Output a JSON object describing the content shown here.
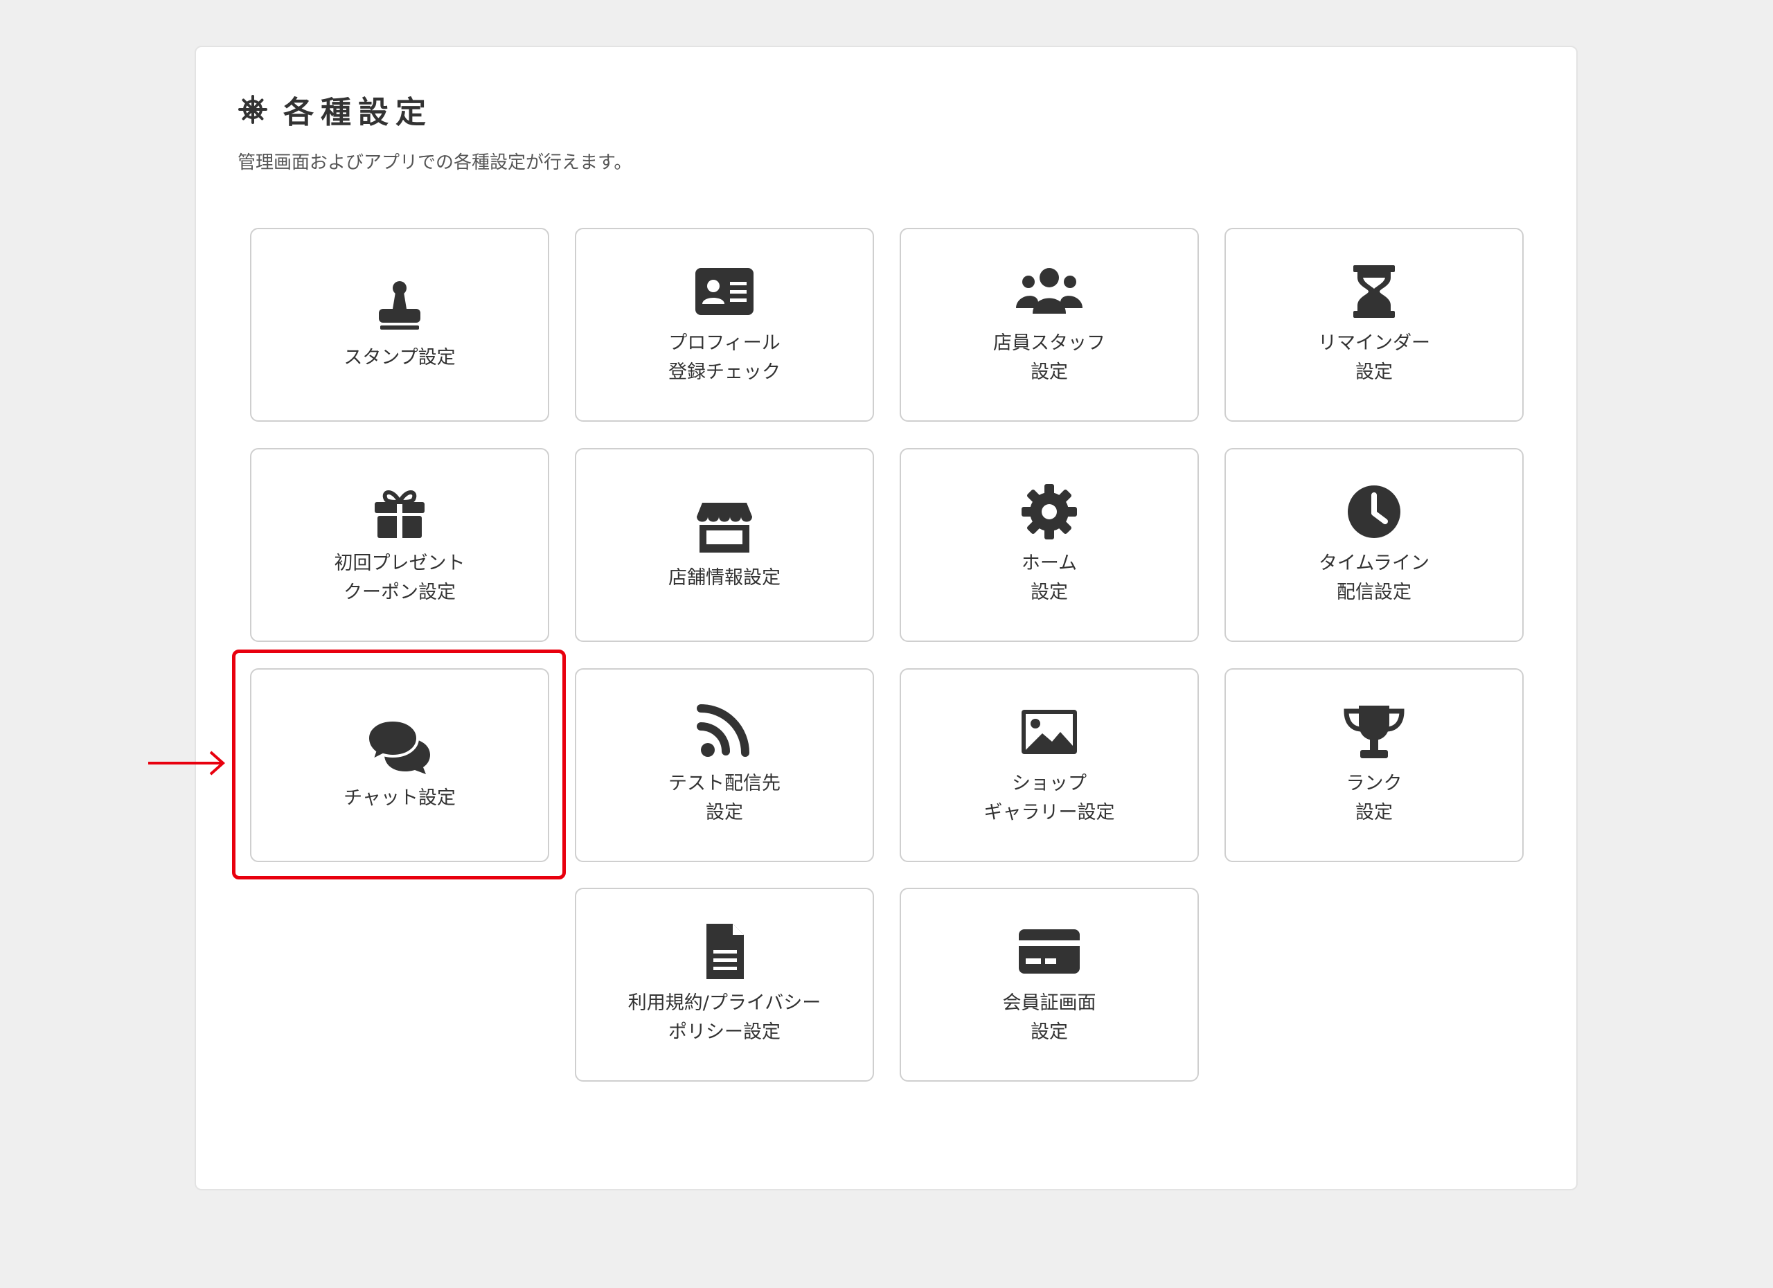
{
  "header": {
    "title": "各種設定",
    "icon": "helm-gear-icon",
    "description": "管理画面およびアプリでの各種設定が行えます。"
  },
  "tiles": [
    {
      "icon": "stamp-icon",
      "lines": [
        "スタンプ設定"
      ]
    },
    {
      "icon": "id-card-icon",
      "lines": [
        "プロフィール",
        "登録チェック"
      ]
    },
    {
      "icon": "users-icon",
      "lines": [
        "店員スタッフ",
        "設定"
      ]
    },
    {
      "icon": "hourglass-icon",
      "lines": [
        "リマインダー",
        "設定"
      ]
    },
    {
      "icon": "gift-icon",
      "lines": [
        "初回プレゼント",
        "クーポン設定"
      ]
    },
    {
      "icon": "store-icon",
      "lines": [
        "店舗情報設定"
      ]
    },
    {
      "icon": "gear-icon",
      "lines": [
        "ホーム",
        "設定"
      ]
    },
    {
      "icon": "clock-icon",
      "lines": [
        "タイムライン",
        "配信設定"
      ]
    },
    {
      "icon": "chat-bubbles-icon",
      "lines": [
        "チャット設定"
      ],
      "highlighted": true
    },
    {
      "icon": "rss-icon",
      "lines": [
        "テスト配信先",
        "設定"
      ]
    },
    {
      "icon": "image-icon",
      "lines": [
        "ショップ",
        "ギャラリー設定"
      ]
    },
    {
      "icon": "trophy-icon",
      "lines": [
        "ランク",
        "設定"
      ]
    },
    {
      "icon": "document-icon",
      "lines": [
        "利用規約/プライバシー",
        "ポリシー設定"
      ]
    },
    {
      "icon": "credit-card-icon",
      "lines": [
        "会員証画面",
        "設定"
      ]
    }
  ],
  "annotation": {
    "highlight_color": "#e8000e",
    "arrow_icon": "arrow-right-icon"
  },
  "colors": {
    "icon": "#333333",
    "background": "#efefef",
    "panel": "#ffffff"
  }
}
